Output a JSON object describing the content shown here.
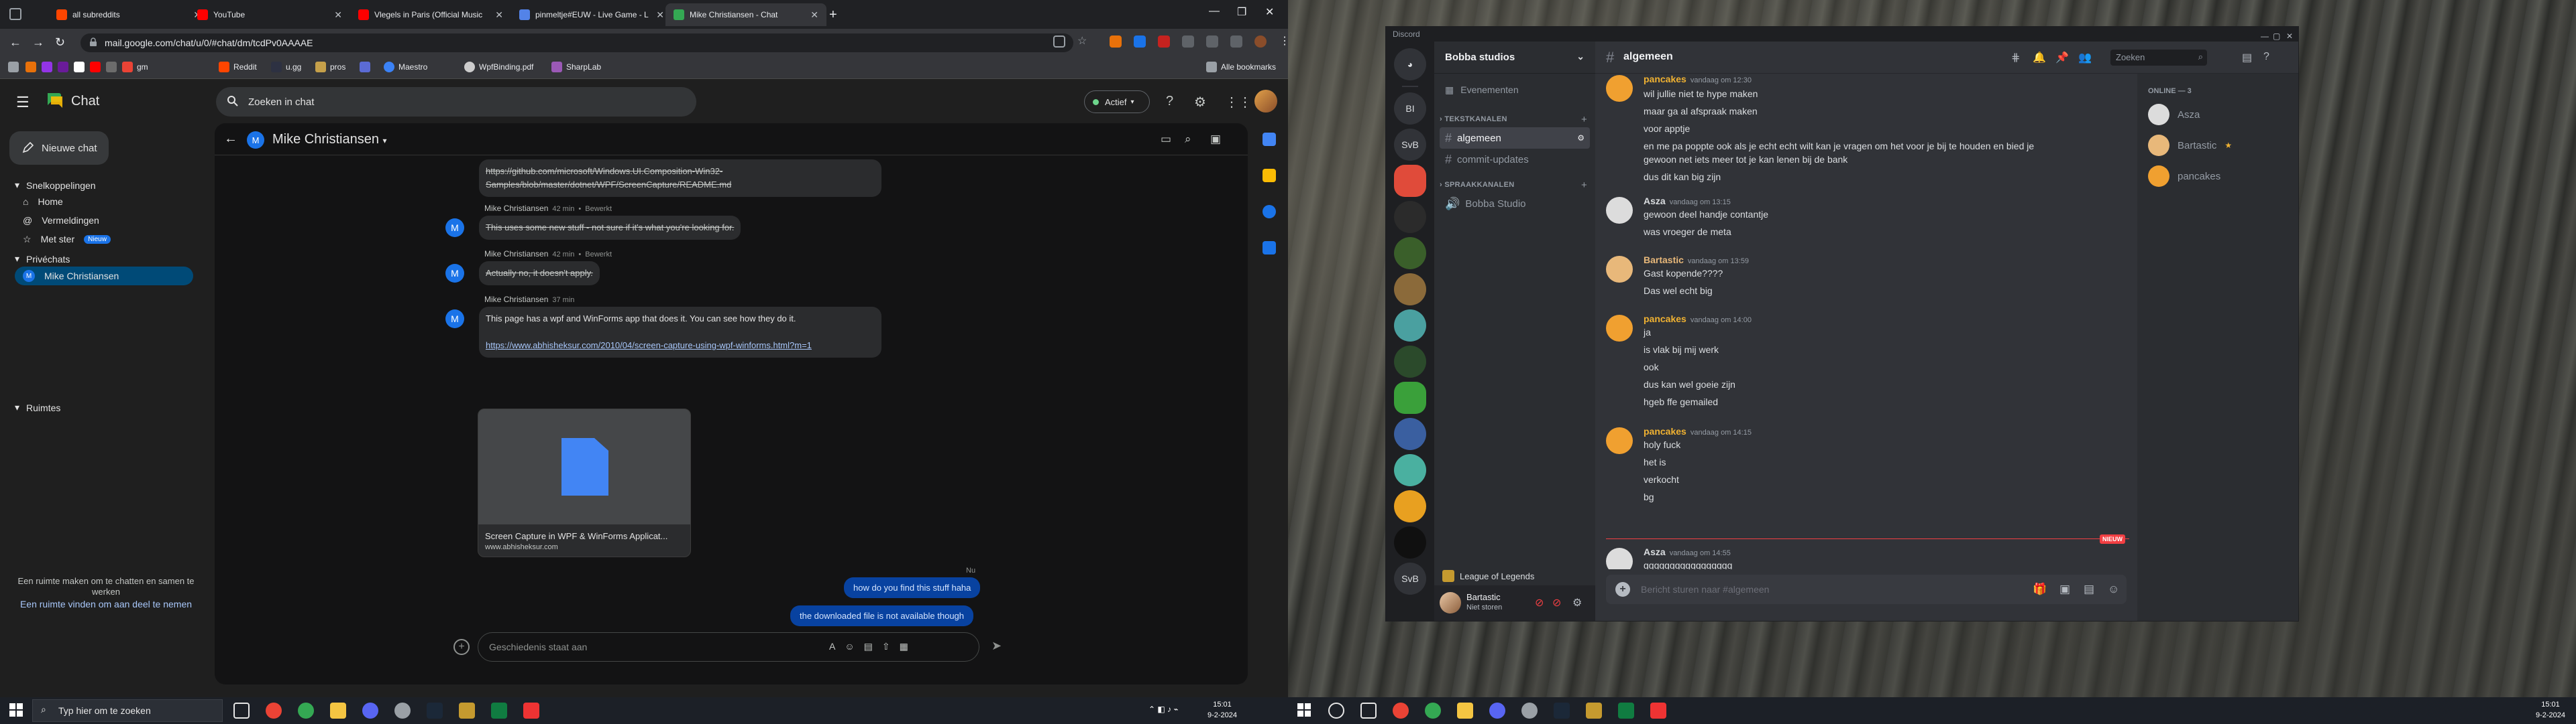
{
  "chrome": {
    "tabs": [
      {
        "title": "all subreddits",
        "color": "#ff4500"
      },
      {
        "title": "YouTube",
        "color": "#ff0000"
      },
      {
        "title": "Vlegels in Paris (Official Music",
        "color": "#ff0000"
      },
      {
        "title": "pinmeltje#EUW - Live Game - L",
        "color": "#5383e8"
      },
      {
        "title": "Mike Christiansen - Chat",
        "color": "#34a853"
      }
    ],
    "url": "mail.google.com/chat/u/0/#chat/dm/tcdPv0AAAAE",
    "bookmarks": [
      {
        "label": "gm",
        "color": "#ea4335"
      },
      {
        "label": "Reddit",
        "color": "#ff4500"
      },
      {
        "label": "u.gg",
        "color": "#2d3142"
      },
      {
        "label": "pros",
        "color": "#c5a04a"
      },
      {
        "label": "",
        "color": "#5b6bd5"
      },
      {
        "label": "Maestro",
        "color": "#3b82f6"
      },
      {
        "label": "WpfBinding.pdf",
        "color": "#cccccc"
      },
      {
        "label": "SharpLab",
        "color": "#9b59b6"
      }
    ],
    "all_bookmarks": "Alle bookmarks"
  },
  "gchat": {
    "app_name": "Chat",
    "search_placeholder": "Zoeken in chat",
    "status": "Actief",
    "new_chat": "Nieuwe chat",
    "shortcuts_header": "Snelkoppelingen",
    "shortcuts": [
      "Home",
      "Vermeldingen",
      "Met ster"
    ],
    "new_badge": "Nieuw",
    "private_header": "Privéchats",
    "private_chat": "Mike Christiansen",
    "spaces_header": "Ruimtes",
    "spaces_text": "Een ruimte maken om te chatten en samen te werken",
    "spaces_link": "Een ruimte vinden om aan deel te nemen",
    "conversation_name": "Mike Christiansen",
    "avatar_initial": "M",
    "messages": [
      {
        "kind": "continued",
        "text": "https://github.com/microsoft/Windows.UI.Composition-Win32-",
        "text2": "Samples/blob/master/dotnet/WPF/ScreenCapture/README.md"
      },
      {
        "sender": "Mike Christiansen",
        "time": "42 min",
        "edited": "Bewerkt",
        "text": "This uses some new stuff - not sure if it's what you're looking for."
      },
      {
        "sender": "Mike Christiansen",
        "time": "42 min",
        "edited": "Bewerkt",
        "text": "Actually no, it doesn't apply."
      },
      {
        "sender": "Mike Christiansen",
        "time": "37 min",
        "text": "This page has a wpf and WinForms app that does it. You can see how they do it.",
        "link": "https://www.abhisheksur.com/2010/04/screen-capture-using-wpf-winforms.html?m=1"
      }
    ],
    "attachment": {
      "title": "Screen Capture in WPF & WinForms Applicat...",
      "domain": "www.abhisheksur.com"
    },
    "now_label": "Nu",
    "outgoing": [
      "how do you find this stuff haha",
      "the downloaded file is not available though"
    ],
    "compose_placeholder": "Geschiedenis staat aan"
  },
  "taskbar_left": {
    "search": "Typ hier om te zoeken",
    "time": "15:01",
    "date": "9-2-2024"
  },
  "taskbar_right": {
    "time": "15:01",
    "date": "9-2-2024"
  },
  "discord": {
    "window_title": "Discord",
    "server_name": "Bobba studios",
    "events": "Evenementen",
    "text_category": "TEKSTKANALEN",
    "text_channels": [
      "algemeen",
      "commit-updates"
    ],
    "voice_category": "SPRAAKKANALEN",
    "voice_channels": [
      "Bobba Studio"
    ],
    "guild_labels": [
      "BI",
      "SvB",
      "SvB"
    ],
    "voice_status": "League of Legends",
    "user": {
      "name": "Bartastic",
      "status": "Niet storen"
    },
    "channel_header": "algemeen",
    "search_placeholder": "Zoeken",
    "input_placeholder": "Bericht sturen naar #algemeen",
    "new_tag": "NIEUW",
    "members_header": "ONLINE — 3",
    "members": [
      {
        "name": "Asza",
        "color": "#dcdcdc"
      },
      {
        "name": "Bartastic",
        "color": "#e8b87a"
      },
      {
        "name": "pancakes",
        "color": "#f0a030"
      }
    ],
    "messages": [
      {
        "user": "pancakes",
        "time": "vandaag om 12:30",
        "color": "#f0b232",
        "lines": [
          "wil jullie niet te hype maken",
          "maar ga al afspraak maken",
          "voor apptje",
          "en me pa poppte ook als je echt echt wilt kan je vragen om het voor je bij te houden en bied je",
          "gewoon net iets meer tot je kan lenen bij de bank",
          "dus dit kan big zijn"
        ]
      },
      {
        "user": "Asza",
        "time": "vandaag om 13:15",
        "color": "#dbdee1",
        "lines": [
          "gewoon deel handje contantje",
          "was vroeger de meta"
        ]
      },
      {
        "user": "Bartastic",
        "time": "vandaag om 13:59",
        "color": "#e8b87a",
        "lines": [
          "Gast kopende????",
          "Das wel echt big"
        ]
      },
      {
        "user": "pancakes",
        "time": "vandaag om 14:00",
        "color": "#f0b232",
        "lines": [
          "ja",
          "is vlak bij mij werk",
          "ook",
          "dus kan wel goeie zijn",
          "hgeb ffe gemailed"
        ]
      },
      {
        "user": "pancakes",
        "time": "vandaag om 14:15",
        "color": "#f0b232",
        "lines": [
          "holy fuck",
          "het is",
          "verkocht",
          "bg"
        ]
      },
      {
        "user": "Asza",
        "time": "vandaag om 14:55",
        "color": "#dbdee1",
        "lines": [
          "ggggggggggggggggg"
        ]
      }
    ]
  }
}
